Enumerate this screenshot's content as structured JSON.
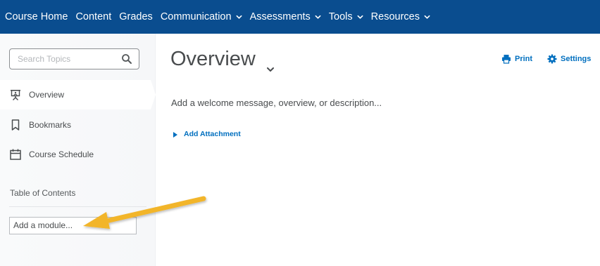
{
  "nav": {
    "items": [
      {
        "label": "Course Home",
        "dropdown": false
      },
      {
        "label": "Content",
        "dropdown": false
      },
      {
        "label": "Grades",
        "dropdown": false
      },
      {
        "label": "Communication",
        "dropdown": true
      },
      {
        "label": "Assessments",
        "dropdown": true
      },
      {
        "label": "Tools",
        "dropdown": true
      },
      {
        "label": "Resources",
        "dropdown": true
      }
    ]
  },
  "sidebar": {
    "search_placeholder": "Search Topics",
    "items": [
      {
        "label": "Overview",
        "icon": "presentation-board-icon",
        "active": true
      },
      {
        "label": "Bookmarks",
        "icon": "bookmark-icon",
        "active": false
      },
      {
        "label": "Course Schedule",
        "icon": "calendar-icon",
        "active": false
      }
    ],
    "toc_label": "Table of Contents",
    "add_module_label": "Add a module..."
  },
  "main": {
    "title": "Overview",
    "print_label": "Print",
    "settings_label": "Settings",
    "welcome_text": "Add a welcome message, overview, or description...",
    "attachment_label": "Add Attachment"
  },
  "colors": {
    "nav_bg": "#0a4d8f",
    "link": "#006fbf",
    "arrow": "#f2b52a",
    "text": "#494c4e"
  }
}
